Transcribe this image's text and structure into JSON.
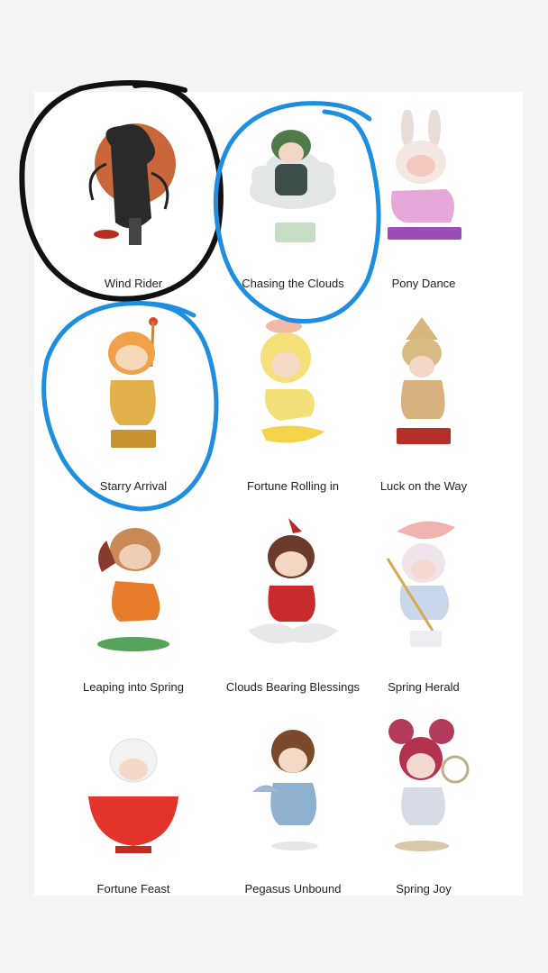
{
  "items": [
    {
      "name": "Wind Rider",
      "circle": "black"
    },
    {
      "name": "Chasing the Clouds",
      "circle": "blue"
    },
    {
      "name": "Pony Dance",
      "circle": null
    },
    {
      "name": "Starry Arrival",
      "circle": "blue"
    },
    {
      "name": "Fortune Rolling in",
      "circle": null
    },
    {
      "name": "Luck on the Way",
      "circle": null
    },
    {
      "name": "Leaping into Spring",
      "circle": null
    },
    {
      "name": "Clouds Bearing Blessings",
      "circle": null
    },
    {
      "name": "Spring Herald",
      "circle": null
    },
    {
      "name": "Fortune Feast",
      "circle": null
    },
    {
      "name": "Pegasus Unbound",
      "circle": null
    },
    {
      "name": "Spring Joy",
      "circle": null
    }
  ],
  "colors": {
    "black_circle": "#111111",
    "blue_circle": "#1e8fe0",
    "background": "#f4f4f4",
    "panel": "#ffffff"
  }
}
